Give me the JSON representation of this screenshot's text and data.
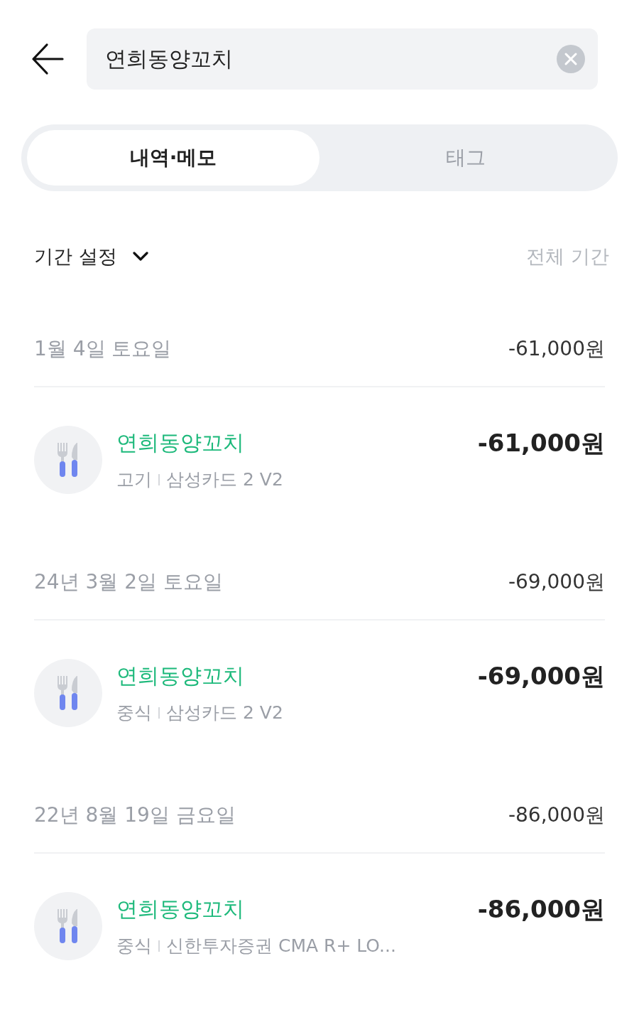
{
  "search": {
    "value": "연희동양꼬치"
  },
  "tabs": [
    {
      "label": "내역·메모",
      "selected": true
    },
    {
      "label": "태그",
      "selected": false
    }
  ],
  "filter": {
    "label": "기간 설정",
    "value": "전체 기간"
  },
  "groups": [
    {
      "date": "1월 4일 토요일",
      "total": "-61,000원",
      "items": [
        {
          "title": "연희동양꼬치",
          "category": "고기",
          "account": "삼성카드 2 V2",
          "amount": "-61,000원"
        }
      ]
    },
    {
      "date": "24년 3월 2일 토요일",
      "total": "-69,000원",
      "items": [
        {
          "title": "연희동양꼬치",
          "category": "중식",
          "account": "삼성카드 2 V2",
          "amount": "-69,000원"
        }
      ]
    },
    {
      "date": "22년 8월 19일 금요일",
      "total": "-86,000원",
      "items": [
        {
          "title": "연희동양꼬치",
          "category": "중식",
          "account": "신한투자증권 CMA R+ LO...",
          "amount": "-86,000원"
        }
      ]
    }
  ]
}
